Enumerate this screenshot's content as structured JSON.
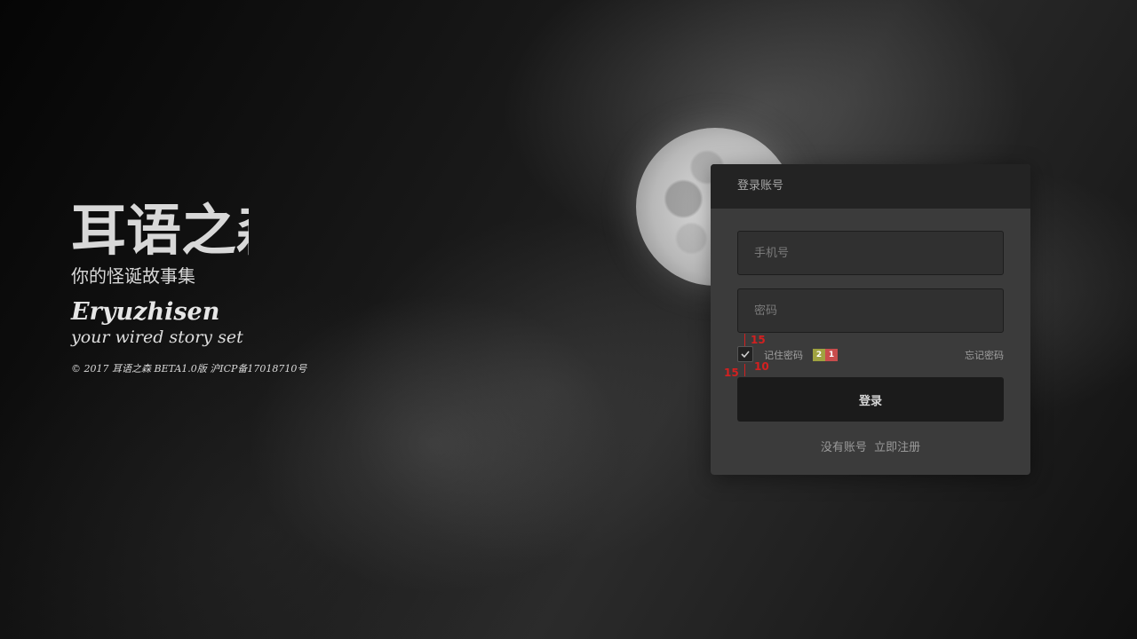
{
  "brand": {
    "logo_text": "耳语之森",
    "logo_subtitle": "你的怪诞故事集",
    "name": "Eryuzhisen",
    "tagline": "your wired story set",
    "copyright": "© 2017 耳语之森 BETA1.0版 沪ICP备17018710号"
  },
  "login": {
    "header": "登录账号",
    "phone_placeholder": "手机号",
    "password_placeholder": "密码",
    "remember_label": "记住密码",
    "remember_checked": true,
    "badge_a": "2",
    "badge_b": "1",
    "forgot_label": "忘记密码",
    "submit_label": "登录",
    "no_account_text": "没有账号",
    "register_link": "立即注册"
  },
  "annotations": {
    "top": "15",
    "left": "15",
    "bottom": "10"
  },
  "colors": {
    "panel": "#3b3b3b",
    "panel_header": "#232323",
    "button": "#1b1b1b",
    "annotation": "#d42020",
    "badge_a": "#9fa240",
    "badge_b": "#c84d4d"
  },
  "icons": {
    "checkbox": "check-icon",
    "moon": "moon-image"
  }
}
